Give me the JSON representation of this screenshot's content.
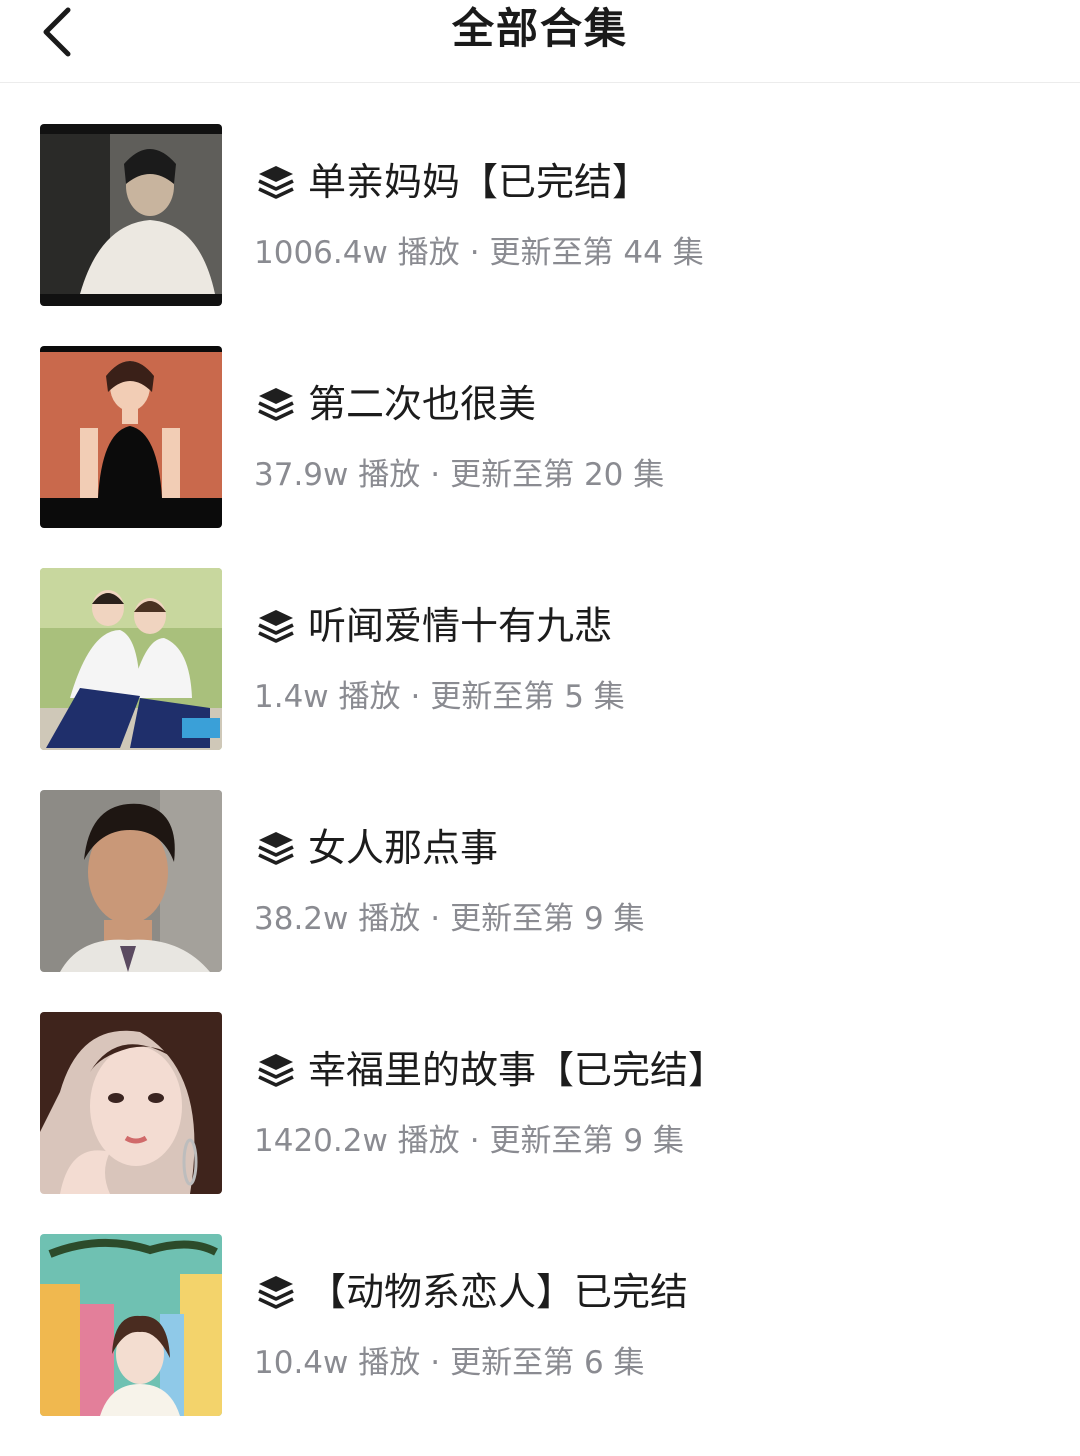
{
  "header": {
    "title": "全部合集",
    "back_icon": "chevron-left-icon"
  },
  "collections": [
    {
      "title": "单亲妈妈【已完结】",
      "plays": "1006.4w 播放",
      "update": "更新至第 44 集",
      "thumb_colors": [
        "#6b6a66",
        "#1a1a1a",
        "#eae6df"
      ]
    },
    {
      "title": "第二次也很美",
      "plays": "37.9w 播放",
      "update": "更新至第 20 集",
      "thumb_colors": [
        "#c9694c",
        "#0b0b0b",
        "#f2cdb5"
      ]
    },
    {
      "title": "听闻爱情十有九悲",
      "plays": "1.4w 播放",
      "update": "更新至第 5 集",
      "thumb_colors": [
        "#9ab46a",
        "#1f2f6b",
        "#f4f4f4"
      ]
    },
    {
      "title": "女人那点事",
      "plays": "38.2w 播放",
      "update": "更新至第 9 集",
      "thumb_colors": [
        "#8d8b86",
        "#2a1f1a",
        "#c99878"
      ]
    },
    {
      "title": "幸福里的故事【已完结】",
      "plays": "1420.2w 播放",
      "update": "更新至第 9 集",
      "thumb_colors": [
        "#d9c5bb",
        "#4a2a22",
        "#f3dcd2"
      ]
    },
    {
      "title": "【动物系恋人】已完结",
      "plays": "10.4w 播放",
      "update": "更新至第 6 集",
      "thumb_colors": [
        "#6fc1b2",
        "#e9a35a",
        "#f3ebd8"
      ]
    }
  ],
  "meta_separator": "·",
  "collection_icon": "layers-stack-icon"
}
